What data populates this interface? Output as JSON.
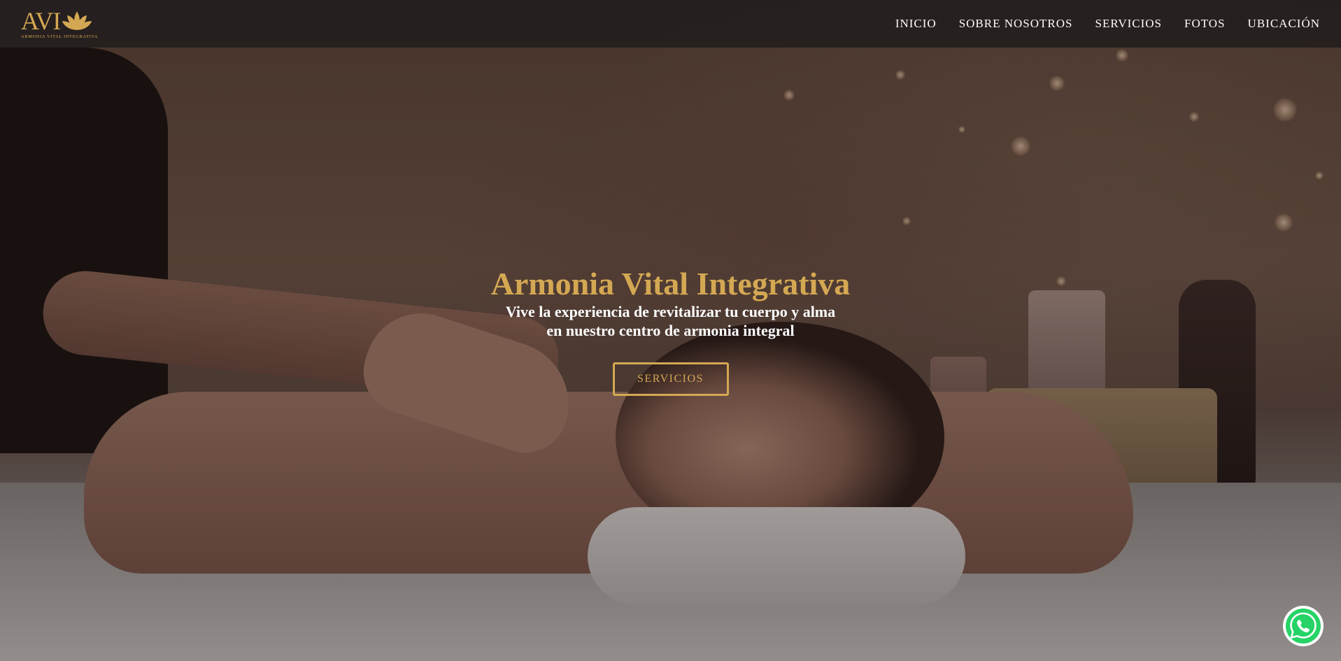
{
  "brand": {
    "logo_text": "AVI",
    "logo_subtitle": "ARMONIA VITAL INTEGRATIVA",
    "accent_color": "#d4a853"
  },
  "nav": {
    "items": [
      {
        "label": "INICIO"
      },
      {
        "label": "SOBRE NOSOTROS"
      },
      {
        "label": "SERVICIOS"
      },
      {
        "label": "FOTOS"
      },
      {
        "label": "UBICACIÓN"
      }
    ]
  },
  "hero": {
    "title": "Armonia Vital Integrativa",
    "subtitle": "Vive la experiencia de revitalizar tu cuerpo y alma en nuestro centro de armonia integral",
    "button_label": "SERVICIOS",
    "background_image": "massage-photo"
  },
  "floating": {
    "whatsapp_icon": "whatsapp-icon",
    "whatsapp_color": "#25d366"
  }
}
